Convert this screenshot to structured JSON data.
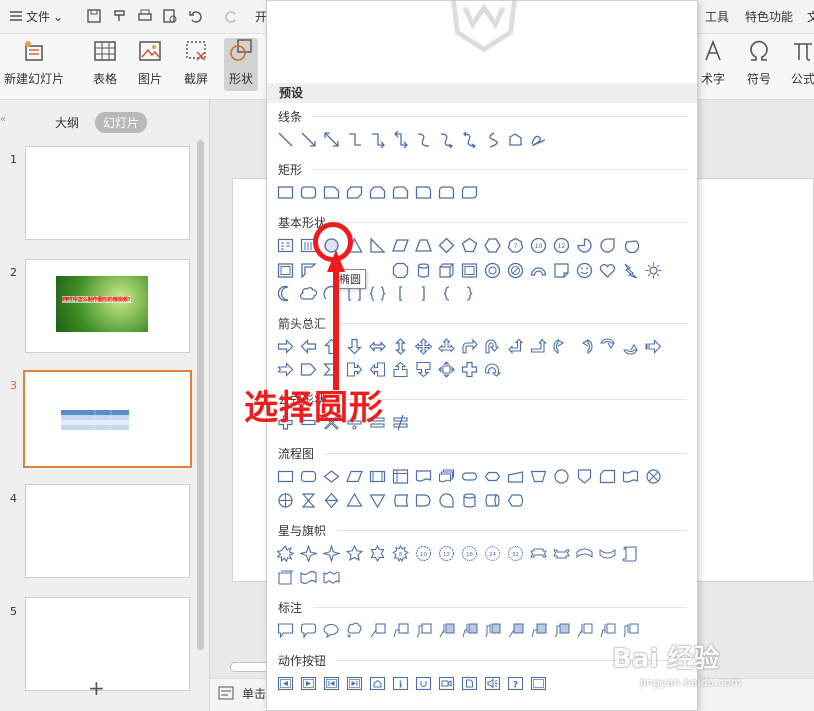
{
  "menubar": {
    "file_label": "文件",
    "cut_label": "开",
    "tools_label": "工具",
    "special_label": "特色功能",
    "right_cut": "文"
  },
  "ribbon": {
    "new_slide": "新建幻灯片",
    "table": "表格",
    "picture": "图片",
    "screenshot": "截屏",
    "shape": "形状",
    "art_text": "术字",
    "symbol": "符号",
    "formula": "公式"
  },
  "panel": {
    "tab_outline": "大纲",
    "tab_slides": "幻灯片",
    "slides": [
      {
        "num": "1"
      },
      {
        "num": "2",
        "thumb_text": "PPT中怎么制作图形的微视频?"
      },
      {
        "num": "3"
      },
      {
        "num": "4"
      },
      {
        "num": "5"
      }
    ],
    "add_symbol": "+"
  },
  "dropdown": {
    "preset": "预设",
    "sections": {
      "lines": "线条",
      "rect": "矩形",
      "basic": "基本形状",
      "arrows": "箭头总汇",
      "equation": "公式形状",
      "flowchart": "流程图",
      "stars": "星与旗帜",
      "callouts": "标注",
      "action": "动作按钮"
    },
    "tooltip": "椭圆"
  },
  "annotation": {
    "text": "选择圆形",
    "color": "#ee1c1c"
  },
  "bottom": {
    "status_text": "单击"
  },
  "watermark": {
    "main": "Bai 经验",
    "sub": "jingyan.baidu.com"
  },
  "colors": {
    "shape_stroke": "#4e6fa8",
    "active_slide": "#e0823b"
  }
}
